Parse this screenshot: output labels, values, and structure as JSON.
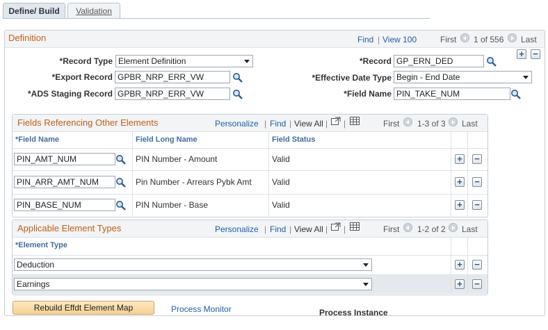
{
  "tabs": [
    {
      "label": "Define/ Build",
      "active": true
    },
    {
      "label": "Validation",
      "active": false
    }
  ],
  "definition": {
    "title": "Definition",
    "nav": {
      "find": "Find",
      "view": "View 100",
      "first": "First",
      "counter": "1 of 556",
      "last": "Last"
    },
    "fields": {
      "record_type": {
        "label": "*Record Type",
        "value": "Element Definition"
      },
      "export_record": {
        "label": "*Export Record",
        "value": "GPBR_NRP_ERR_VW"
      },
      "ads_staging_record": {
        "label": "*ADS Staging Record",
        "value": "GPBR_NRP_ERR_VW"
      },
      "record": {
        "label": "*Record",
        "value": "GP_ERN_DED"
      },
      "effective_date_type": {
        "label": "*Effective Date Type",
        "value": "Begin - End Date"
      },
      "field_name": {
        "label": "*Field Name",
        "value": "PIN_TAKE_NUM"
      }
    }
  },
  "fields_ref": {
    "title": "Fields Referencing Other Elements",
    "nav": {
      "personalize": "Personalize",
      "find": "Find",
      "view_all": "View All",
      "first": "First",
      "counter": "1-3 of 3",
      "last": "Last"
    },
    "columns": [
      "*Field Name",
      "Field Long Name",
      "Field Status"
    ],
    "rows": [
      {
        "field_name": "PIN_AMT_NUM",
        "long_name": "PIN Number - Amount",
        "status": "Valid"
      },
      {
        "field_name": "PIN_ARR_AMT_NUM",
        "long_name": "Pin Number - Arrears Pybk Amt",
        "status": "Valid"
      },
      {
        "field_name": "PIN_BASE_NUM",
        "long_name": "PIN Number - Base",
        "status": "Valid"
      }
    ]
  },
  "element_types": {
    "title": "Applicable Element Types",
    "nav": {
      "personalize": "Personalize",
      "find": "Find",
      "view_all": "View All",
      "first": "First",
      "counter": "1-2 of 2",
      "last": "Last"
    },
    "column": "*Element Type",
    "rows": [
      {
        "value": "Deduction"
      },
      {
        "value": "Earnings"
      }
    ]
  },
  "footer": {
    "rebuild_button": "Rebuild Effdt Element Map",
    "process_monitor": "Process Monitor",
    "process_instance": "Process Instance"
  },
  "colors": {
    "accent_title": "#c0601a",
    "link": "#1f5fa8",
    "button": "#f6d191"
  }
}
